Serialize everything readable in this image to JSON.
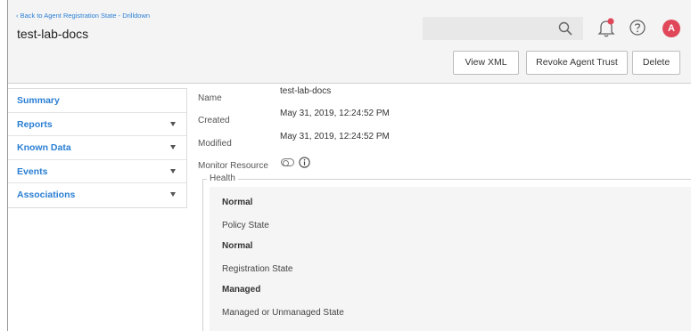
{
  "header": {
    "back_link": "‹ Back to Agent Registration State - Drilldown",
    "title": "test-lab-docs",
    "avatar_initial": "A",
    "icons": [
      "search-icon",
      "bell-icon",
      "help-icon"
    ],
    "notification_dot_color": "#e0485a"
  },
  "actions": {
    "view_xml": "View XML",
    "revoke_agent_trust": "Revoke Agent Trust",
    "delete": "Delete"
  },
  "sidebar": {
    "items": [
      {
        "label": "Summary",
        "expandable": false
      },
      {
        "label": "Reports",
        "expandable": true
      },
      {
        "label": "Known Data",
        "expandable": true
      },
      {
        "label": "Events",
        "expandable": true
      },
      {
        "label": "Associations",
        "expandable": true
      }
    ]
  },
  "details": {
    "name_label": "Name",
    "name_value": "test-lab-docs",
    "created_label": "Created",
    "created_value": "May 31, 2019, 12:24:52 PM",
    "modified_label": "Modified",
    "modified_value": "May 31, 2019, 12:24:52 PM",
    "monitor_label": "Monitor Resource",
    "monitor_enabled": false
  },
  "health": {
    "legend": "Health",
    "status_value": "Normal",
    "policy_value": "Normal",
    "policy_label": "Policy State",
    "registration_value": "Managed",
    "registration_label": "Registration State",
    "managed_label": "Managed or Unmanaged State"
  },
  "colors": {
    "accent": "#2a7fd4",
    "avatar": "#e0485a"
  }
}
